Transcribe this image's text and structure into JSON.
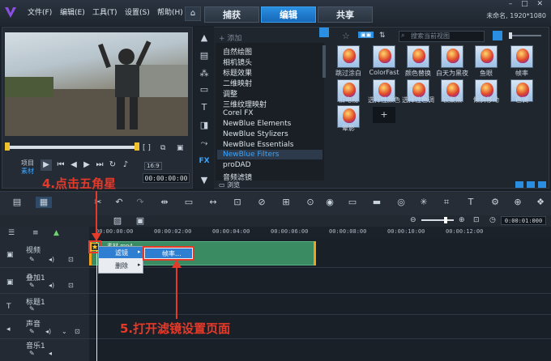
{
  "menu": [
    "文件(F)",
    "编辑(E)",
    "工具(T)",
    "设置(S)",
    "帮助(H)"
  ],
  "tabs": {
    "capture": "捕获",
    "edit": "编辑",
    "share": "共享"
  },
  "project_info": "未命名, 1920*1080",
  "preview": {
    "mode_project": "项目",
    "mode_clip": "素材",
    "timecode": "00:00:00:00",
    "zoom": "16:9"
  },
  "library": {
    "add_label": "添加",
    "browse_label": "浏览",
    "search_placeholder": "搜索当前视图",
    "filters": [
      "自然绘图",
      "相机镜头",
      "标题效果",
      "二维映射",
      "调整",
      "三维纹理映射",
      "Corel FX",
      "NewBlue Elements",
      "NewBlue Stylizers",
      "NewBlue Essentials",
      "NewBlue Filters",
      "proDAD",
      "音频滤镜"
    ],
    "selected_filter": "NewBlue Filters",
    "thumbs_row1": [
      "跳过涂白",
      "ColorFast",
      "颜色替换",
      "白天为黑夜",
      "鱼眼",
      "帧率"
    ],
    "thumbs_row2": [
      "旧电视",
      "选择性颜色",
      "选择性色调",
      "软聚焦",
      "倾斜移动",
      "色调"
    ],
    "thumbs_row3": [
      "晕影"
    ]
  },
  "timeline": {
    "timecode": "0:00:01:000",
    "ruler": [
      "00:00:00:00",
      "00:00:02:00",
      "00:00:04:00",
      "00:00:06:00",
      "00:00:08:00",
      "00:00:10:00",
      "00:00:12:00"
    ],
    "tracks": [
      "视频",
      "叠加1",
      "标题1",
      "声音",
      "音乐1"
    ],
    "clip_label": "素材.mp4"
  },
  "context_menu": {
    "item1": "滤镜",
    "item2": "删除",
    "submenu_item": "帧率..."
  },
  "annotations": {
    "step4": "4.点击五角星",
    "step5": "5.打开滤镜设置页面"
  },
  "colors": {
    "accent": "#2a8fe0",
    "annotation": "#e53a2a",
    "clip": "#3a8a62",
    "selected_text": "#3aa6ff"
  }
}
